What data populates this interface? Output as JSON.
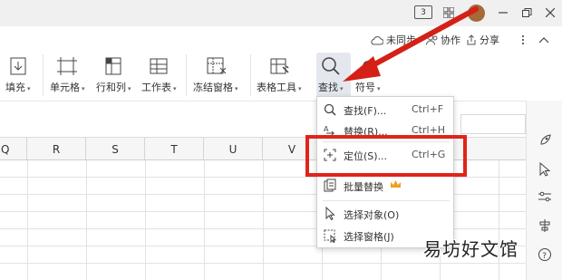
{
  "titlebar": {
    "view_badge": "3"
  },
  "collab": {
    "sync": "未同步",
    "cowork": "协作",
    "share": "分享"
  },
  "ribbon": {
    "fill": "填充",
    "cell": "单元格",
    "rowcol": "行和列",
    "sheet": "工作表",
    "freeze": "冻结窗格",
    "table_tools": "表格工具",
    "find": "查找",
    "symbol": "符号"
  },
  "columns": [
    "Q",
    "R",
    "S",
    "T",
    "U",
    "V"
  ],
  "dropdown": {
    "find": {
      "label": "查找(F)...",
      "shortcut": "Ctrl+F"
    },
    "replace": {
      "label": "替换(R)...",
      "shortcut": "Ctrl+H"
    },
    "goto": {
      "label": "定位(S)...",
      "shortcut": "Ctrl+G"
    },
    "batch_replace": "批量替换",
    "select_objects": "选择对象(O)",
    "select_pane": "选择窗格(J)"
  },
  "watermark": "易坊好文馆",
  "colors": {
    "arrow": "#e0241a",
    "highlight_box": "#e0241a",
    "crown": "#f0a020"
  }
}
